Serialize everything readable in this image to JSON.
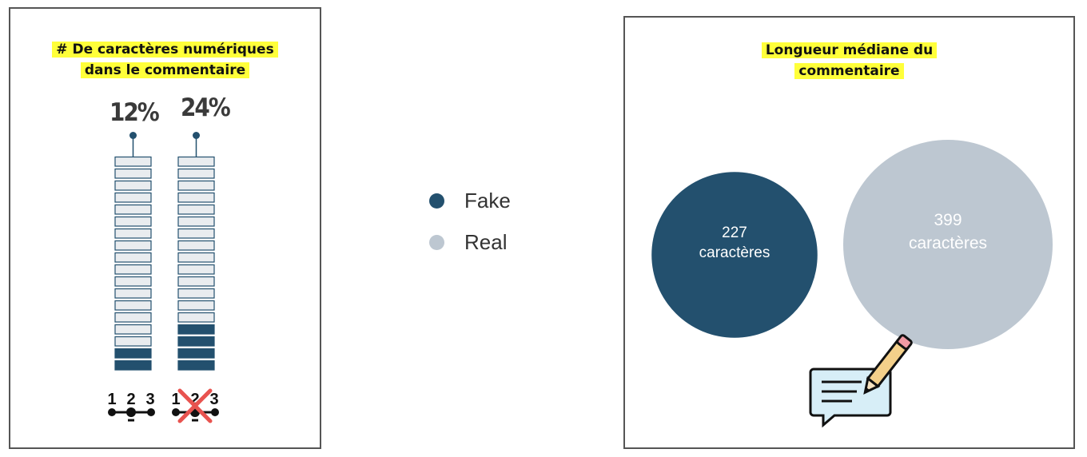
{
  "chart_data": [
    {
      "type": "bar",
      "title": "# De caractères numériques dans le commentaire",
      "categories": [
        "Fake",
        "Real"
      ],
      "values": [
        12,
        24
      ],
      "value_labels": [
        "12%",
        "24%"
      ],
      "unit": "%",
      "ylim": [
        0,
        100
      ]
    },
    {
      "type": "bubble",
      "title": "Longueur médiane du commentaire",
      "categories": [
        "Fake",
        "Real"
      ],
      "values": [
        227,
        399
      ],
      "value_labels": [
        [
          "227",
          "caractères"
        ],
        [
          "399",
          "caractères"
        ]
      ]
    }
  ],
  "legend": [
    {
      "label": "Fake",
      "color": "#23506e"
    },
    {
      "label": "Real",
      "color": "#bdc7d1"
    }
  ],
  "colors": {
    "fake": "#23506e",
    "real": "#bdc7d1",
    "empty_segment": "#e9ecef",
    "highlight": "#ffff3a",
    "cross": "#e8534f"
  },
  "icons": {
    "fake_digits": "digits-123-icon",
    "real_digits": "digits-123-crossed-icon",
    "comment": "comment-pencil-icon"
  },
  "icon_text": {
    "digits": [
      "1",
      "2",
      "3"
    ]
  },
  "title_lines": {
    "left": [
      "# De caractères numériques",
      "dans le commentaire"
    ],
    "right": [
      "Longueur médiane du",
      "commentaire"
    ]
  }
}
